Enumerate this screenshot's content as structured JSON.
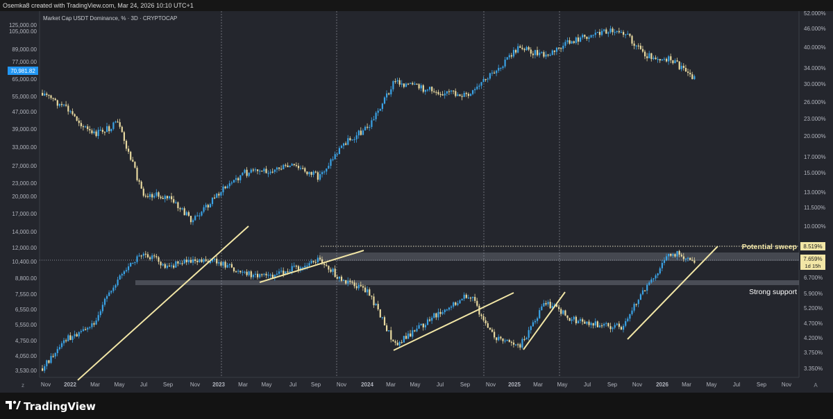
{
  "header": {
    "credit": "Osemka8 created with TradingView.com, Mar 24, 2026 10:10 UTC+1"
  },
  "legend": {
    "series_title": "Market Cap USDT Dominance, % · 3D · CRYPTOCAP"
  },
  "footer": {
    "brand": "TradingView"
  },
  "colors": {
    "background": "#24262d",
    "candle_blue": "#3aa3e6",
    "candle_yellow": "#e8d9a0",
    "trendline": "#f2e6a6",
    "zone": "#9aa3ad"
  },
  "chart_data": {
    "type": "line",
    "title": "Market Cap USDT Dominance, % · 3D · CRYPTOCAP",
    "x_ticks": [
      "Nov",
      "2022",
      "Mar",
      "May",
      "Jul",
      "Sep",
      "Nov",
      "2023",
      "Mar",
      "May",
      "Jul",
      "Sep",
      "Nov",
      "2024",
      "Mar",
      "May",
      "Jul",
      "Sep",
      "Nov",
      "2025",
      "Mar",
      "May",
      "Jul",
      "Sep",
      "Nov",
      "2026",
      "Mar",
      "May",
      "Jul",
      "Sep",
      "Nov"
    ],
    "left_axis": {
      "label": "Market Cap",
      "scale": "log",
      "ticks": [
        "125,000.00",
        "105,000.00",
        "89,000.00",
        "77,000.00",
        "65,000.00",
        "55,000.00",
        "47,000.00",
        "39,000.00",
        "33,000.00",
        "27,000.00",
        "23,000.00",
        "20,000.00",
        "17,000.00",
        "14,000.00",
        "12,000.00",
        "10,400.00",
        "8,800.00",
        "7,550.00",
        "6,550.00",
        "5,550.00",
        "4,750.00",
        "4,050.00",
        "3,530.00"
      ],
      "current_value": "70,981.82"
    },
    "right_axis": {
      "label": "USDT Dominance, %",
      "scale": "log",
      "ticks": [
        "52.000%",
        "46.000%",
        "40.000%",
        "34.000%",
        "30.000%",
        "26.000%",
        "23.000%",
        "20.000%",
        "17.000%",
        "15.000%",
        "13.000%",
        "11.500%",
        "10.000%",
        "8.519%",
        "7.659%",
        "6.700%",
        "5.900%",
        "5.200%",
        "4.700%",
        "4.200%",
        "3.750%",
        "3.350%"
      ],
      "current_value": "7.659%",
      "countdown": "1d 15h",
      "sweep_level": "8.519%"
    },
    "series": [
      {
        "name": "Market Cap",
        "x": [
          "2021-11",
          "2022-01",
          "2022-03",
          "2022-05",
          "2022-07",
          "2022-09",
          "2022-11",
          "2023-01",
          "2023-03",
          "2023-05",
          "2023-07",
          "2023-09",
          "2023-11",
          "2024-01",
          "2024-03",
          "2024-05",
          "2024-07",
          "2024-09",
          "2024-11",
          "2025-01",
          "2025-03",
          "2025-05",
          "2025-07",
          "2025-09",
          "2025-11",
          "2026-01",
          "2026-03"
        ],
        "values": [
          62000,
          52000,
          40000,
          45000,
          22000,
          21000,
          16500,
          22000,
          27000,
          28000,
          29000,
          26000,
          37000,
          44000,
          70000,
          65000,
          62000,
          60000,
          78000,
          100000,
          90000,
          105000,
          115000,
          120000,
          92000,
          87000,
          70981
        ]
      },
      {
        "name": "USDT Dominance, %",
        "x": [
          "2021-11",
          "2022-01",
          "2022-03",
          "2022-05",
          "2022-07",
          "2022-09",
          "2022-11",
          "2023-01",
          "2023-03",
          "2023-05",
          "2023-07",
          "2023-09",
          "2023-11",
          "2024-01",
          "2024-03",
          "2024-05",
          "2024-07",
          "2024-09",
          "2024-11",
          "2025-01",
          "2025-03",
          "2025-05",
          "2025-07",
          "2025-09",
          "2025-11",
          "2026-01",
          "2026-03"
        ],
        "values": [
          3.35,
          4.2,
          4.7,
          6.7,
          8.2,
          7.3,
          7.8,
          7.6,
          6.9,
          6.8,
          7.2,
          7.8,
          6.5,
          6.0,
          4.0,
          4.6,
          5.3,
          5.9,
          4.2,
          4.0,
          5.6,
          4.9,
          4.7,
          4.6,
          6.3,
          8.2,
          7.659
        ]
      }
    ],
    "annotations": {
      "sweep_label": "Potential sweep",
      "support_label": "Strong support"
    },
    "grid": false,
    "legend_position": "top-left"
  }
}
